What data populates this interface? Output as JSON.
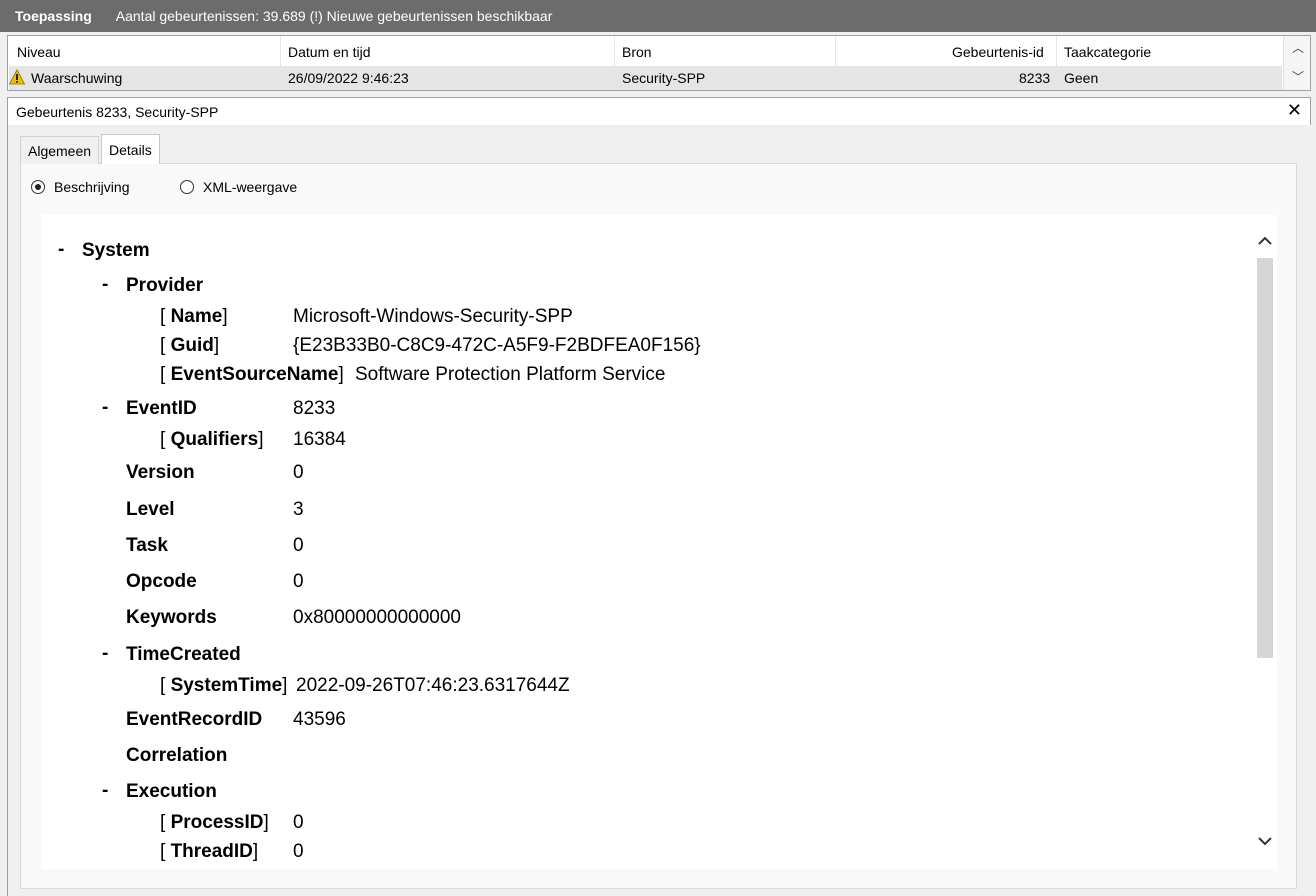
{
  "header": {
    "app_label": "Toepassing",
    "count_text": "Aantal gebeurtenissen: 39.689 (!) Nieuwe gebeurtenissen beschikbaar"
  },
  "event_list": {
    "columns": [
      "Niveau",
      "Datum en tijd",
      "Bron",
      "Gebeurtenis-id",
      "Taakcategorie"
    ],
    "row": {
      "level": "Waarschuwing",
      "datetime": "26/09/2022 9:46:23",
      "source": "Security-SPP",
      "event_id": "8233",
      "category": "Geen"
    }
  },
  "detail": {
    "title": "Gebeurtenis 8233, Security-SPP",
    "close": "✕",
    "tabs": [
      "Algemeen",
      "Details"
    ],
    "radios": [
      "Beschrijving",
      "XML-weergave"
    ]
  },
  "tree": {
    "system": "System",
    "provider": "Provider",
    "name_key": "Name",
    "name_val": "Microsoft-Windows-Security-SPP",
    "guid_key": "Guid",
    "guid_val": "{E23B33B0-C8C9-472C-A5F9-F2BDFEA0F156}",
    "esn_key": "EventSourceName",
    "esn_val": "Software Protection Platform Service",
    "eventid_key": "EventID",
    "eventid_val": "8233",
    "qual_key": "Qualifiers",
    "qual_val": "16384",
    "version_key": "Version",
    "version_val": "0",
    "level_key": "Level",
    "level_val": "3",
    "task_key": "Task",
    "task_val": "0",
    "opcode_key": "Opcode",
    "opcode_val": "0",
    "keywords_key": "Keywords",
    "keywords_val": "0x80000000000000",
    "timecreated_key": "TimeCreated",
    "systemtime_key": "SystemTime",
    "systemtime_val": "2022-09-26T07:46:23.6317644Z",
    "recordid_key": "EventRecordID",
    "recordid_val": "43596",
    "correlation_key": "Correlation",
    "execution_key": "Execution",
    "processid_key": "ProcessID",
    "processid_val": "0",
    "threadid_key": "ThreadID",
    "threadid_val": "0"
  }
}
